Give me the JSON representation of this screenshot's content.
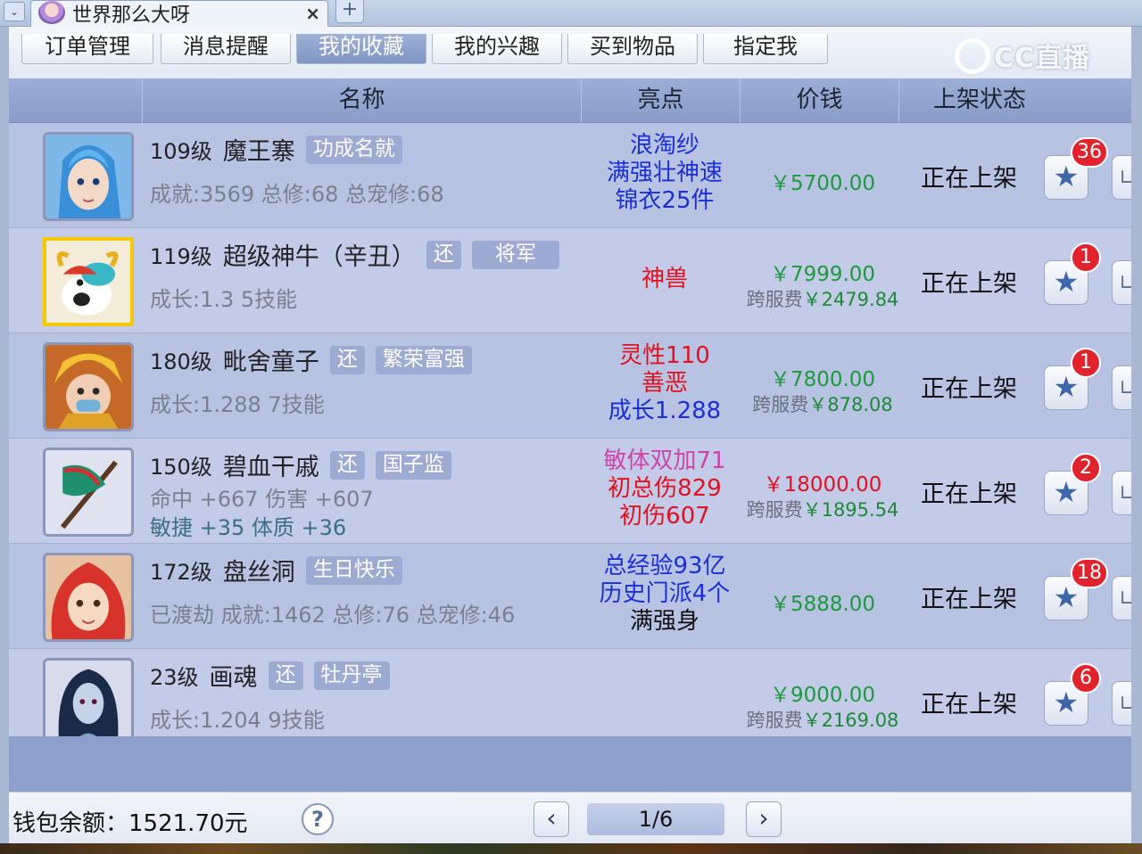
{
  "window": {
    "dropdown_glyph": "⌄",
    "tab_title": "世界那么大呀",
    "close_glyph": "×",
    "new_tab_glyph": "+"
  },
  "nav": {
    "items": [
      "订单管理",
      "消息提醒",
      "我的收藏",
      "我的兴趣",
      "买到物品",
      "指定我"
    ],
    "active_index": 2
  },
  "watermark": "CC直播",
  "table": {
    "headers": [
      "名称",
      "亮点",
      "价钱",
      "上架状态"
    ]
  },
  "rows": [
    {
      "level": "109级",
      "name": "魔王寨",
      "tags": [
        "功成名就"
      ],
      "sub": [
        "成就:3569  总修:68  总宠修:68"
      ],
      "highlights": [
        {
          "text": "浪淘纱",
          "color": "blue"
        },
        {
          "text": "满强壮神速",
          "color": "blue"
        },
        {
          "text": "锦衣25件",
          "color": "blue"
        }
      ],
      "price": "￥5700.00",
      "price_color": "green",
      "fee_label": "",
      "fee_value": "",
      "status": "正在上架",
      "fav_count": "36",
      "avatar": "blue-hair-hero"
    },
    {
      "level": "119级",
      "name": "超级神牛（辛丑）",
      "tags": [
        "还",
        "将军"
      ],
      "sub": [
        "成长:1.3  5技能"
      ],
      "highlights": [
        {
          "text": "神兽",
          "color": "red"
        }
      ],
      "price": "￥7999.00",
      "price_color": "green",
      "fee_label": "跨服费",
      "fee_value": "￥2479.84",
      "status": "正在上架",
      "fav_count": "1",
      "avatar": "divine-ox",
      "selected": true
    },
    {
      "level": "180级",
      "name": "毗舍童子",
      "tags": [
        "还",
        "繁荣富强"
      ],
      "sub": [
        "成长:1.288  7技能"
      ],
      "highlights": [
        {
          "text": "灵性110",
          "color": "red"
        },
        {
          "text": "善恶",
          "color": "red"
        },
        {
          "text": "成长1.288",
          "color": "blue"
        }
      ],
      "price": "￥7800.00",
      "price_color": "green",
      "fee_label": "跨服费",
      "fee_value": "￥878.08",
      "status": "正在上架",
      "fav_count": "1",
      "avatar": "golden-child"
    },
    {
      "level": "150级",
      "name": "碧血干戚",
      "tags": [
        "还",
        "国子监"
      ],
      "sub": [
        "命中 +667  伤害 +607",
        "敏捷 +35  体质 +36"
      ],
      "highlights": [
        {
          "text": "敏体双加71",
          "color": "pink"
        },
        {
          "text": "初总伤829",
          "color": "red"
        },
        {
          "text": "初伤607",
          "color": "red"
        }
      ],
      "price": "￥18000.00",
      "price_color": "red",
      "fee_label": "跨服费",
      "fee_value": "￥1895.54",
      "status": "正在上架",
      "fav_count": "2",
      "avatar": "green-axe"
    },
    {
      "level": "172级",
      "name": "盘丝洞",
      "tags": [
        "生日快乐"
      ],
      "sub": [
        "已渡劫  成就:1462  总修:76  总宠修:46"
      ],
      "highlights": [
        {
          "text": "总经验93亿",
          "color": "blue"
        },
        {
          "text": "历史门派4个",
          "color": "blue"
        },
        {
          "text": "满强身",
          "color": "dark"
        }
      ],
      "price": "￥5888.00",
      "price_color": "green",
      "fee_label": "",
      "fee_value": "",
      "status": "正在上架",
      "fav_count": "18",
      "avatar": "red-hair-girl"
    },
    {
      "level": "23级",
      "name": "画魂",
      "tags": [
        "还",
        "牡丹亭"
      ],
      "sub": [
        "成长:1.204  9技能"
      ],
      "highlights": [],
      "price": "￥9000.00",
      "price_color": "green",
      "fee_label": "跨服费",
      "fee_value": "￥2169.08",
      "status": "正在上架",
      "fav_count": "6",
      "avatar": "ghost-lady"
    }
  ],
  "footer": {
    "wallet_label": "钱包余额：",
    "wallet_value": "1521.70元",
    "help_glyph": "?",
    "prev_glyph": "‹",
    "next_glyph": "›",
    "page_indicator": "1/6"
  },
  "icons": {
    "favorite": "star-icon",
    "cart": "cart-icon"
  }
}
